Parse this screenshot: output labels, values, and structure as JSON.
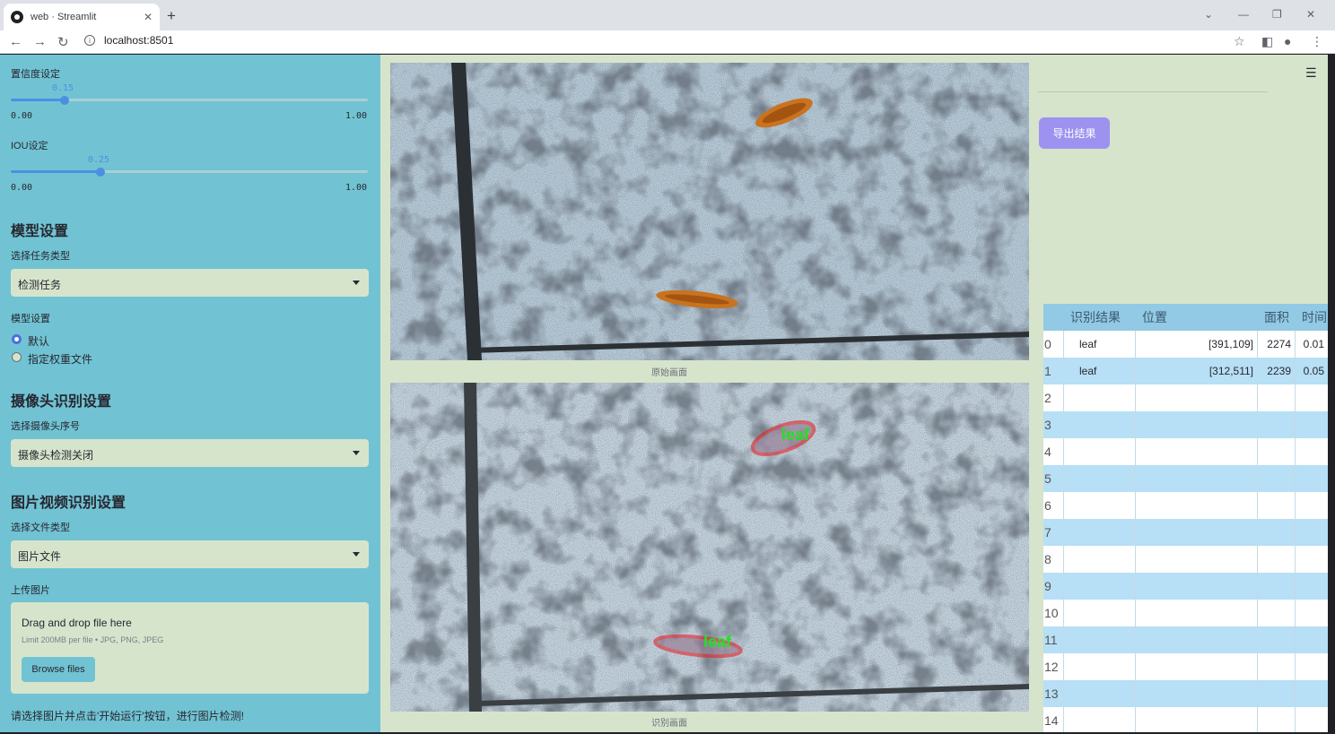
{
  "browser": {
    "tab_title": "web · Streamlit",
    "url": "localhost:8501"
  },
  "sidebar": {
    "confidence": {
      "label": "置信度设定",
      "value": "0.15",
      "min": "0.00",
      "max": "1.00",
      "fraction": 0.15
    },
    "iou": {
      "label": "IOU设定",
      "value": "0.25",
      "min": "0.00",
      "max": "1.00",
      "fraction": 0.25
    },
    "model_header": "模型设置",
    "task_label": "选择任务类型",
    "task_value": "检测任务",
    "model_label": "模型设置",
    "model_options": [
      "默认",
      "指定权重文件"
    ],
    "model_selected": 0,
    "camera_header": "摄像头识别设置",
    "camera_label": "选择摄像头序号",
    "camera_value": "摄像头检测关闭",
    "media_header": "图片视频识别设置",
    "file_type_label": "选择文件类型",
    "file_type_value": "图片文件",
    "upload_label": "上传图片",
    "upload_drag": "Drag and drop file here",
    "upload_limit": "Limit 200MB per file • JPG, PNG, JPEG",
    "browse_label": "Browse files",
    "hint": "请选择图片并点击'开始运行'按钮，进行图片检测!"
  },
  "main": {
    "original_caption": "原始画面",
    "result_caption": "识别画面",
    "detection_label": "leaf",
    "export_label": "导出结果"
  },
  "table": {
    "columns": [
      "",
      "识别结果",
      "位置",
      "面积",
      "时间"
    ],
    "rows": [
      [
        "0",
        "leaf",
        "[391,109]",
        "2274",
        "0.01"
      ],
      [
        "1",
        "leaf",
        "[312,511]",
        "2239",
        "0.05"
      ],
      [
        "2",
        "",
        "",
        "",
        ""
      ],
      [
        "3",
        "",
        "",
        "",
        ""
      ],
      [
        "4",
        "",
        "",
        "",
        ""
      ],
      [
        "5",
        "",
        "",
        "",
        ""
      ],
      [
        "6",
        "",
        "",
        "",
        ""
      ],
      [
        "7",
        "",
        "",
        "",
        ""
      ],
      [
        "8",
        "",
        "",
        "",
        ""
      ],
      [
        "9",
        "",
        "",
        "",
        ""
      ],
      [
        "10",
        "",
        "",
        "",
        ""
      ],
      [
        "11",
        "",
        "",
        "",
        ""
      ],
      [
        "12",
        "",
        "",
        "",
        ""
      ],
      [
        "13",
        "",
        "",
        "",
        ""
      ],
      [
        "14",
        "",
        "",
        "",
        ""
      ]
    ]
  },
  "colors": {
    "sidebar_bg": "#71c3d3",
    "main_bg": "#d6e4cc",
    "slider_accent": "#4a90e2",
    "export_button": "#9d92f0",
    "table_header": "#92c9e4",
    "table_row_alt": "#b7dff5",
    "detection_box": "#e8131a",
    "detection_text": "#22e022"
  }
}
